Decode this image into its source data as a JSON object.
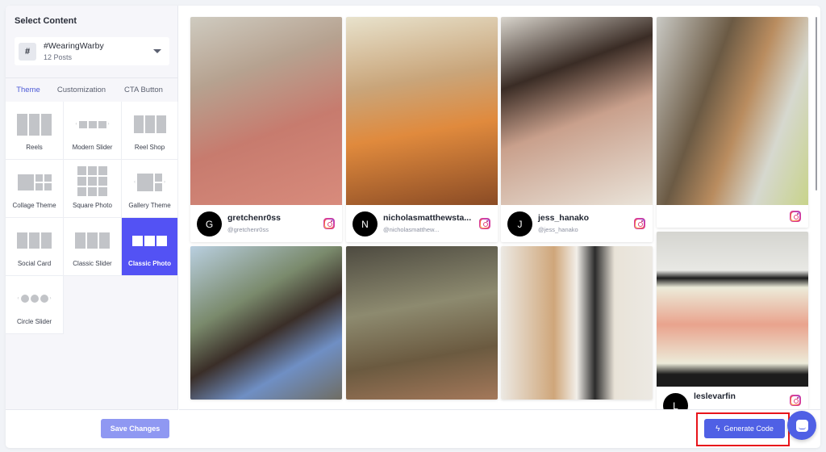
{
  "sidebar": {
    "title": "Select Content",
    "source": {
      "icon": "#",
      "name": "#WearingWarby",
      "count": "12 Posts"
    },
    "tabs": [
      {
        "label": "Theme",
        "active": true
      },
      {
        "label": "Customization",
        "active": false
      },
      {
        "label": "CTA Button",
        "active": false
      }
    ],
    "themes": [
      {
        "label": "Reels",
        "icon": "reels-layout-icon",
        "active": false
      },
      {
        "label": "Modern Slider",
        "icon": "modern-slider-layout-icon",
        "active": false
      },
      {
        "label": "Reel Shop",
        "icon": "reel-shop-layout-icon",
        "active": false
      },
      {
        "label": "Collage Theme",
        "icon": "collage-layout-icon",
        "active": false
      },
      {
        "label": "Square Photo",
        "icon": "square-photo-layout-icon",
        "active": false
      },
      {
        "label": "Gallery Theme",
        "icon": "gallery-layout-icon",
        "active": false
      },
      {
        "label": "Social Card",
        "icon": "social-card-layout-icon",
        "active": false
      },
      {
        "label": "Classic Slider",
        "icon": "classic-slider-layout-icon",
        "active": false
      },
      {
        "label": "Classic Photo",
        "icon": "classic-photo-layout-icon",
        "active": true
      },
      {
        "label": "Circle Slider",
        "icon": "circle-slider-layout-icon",
        "active": false
      }
    ],
    "save_label": "Save Changes"
  },
  "feed": {
    "posts": [
      {
        "initial": "G",
        "name": "gretchenr0ss",
        "handle": "@gretchenr0ss",
        "photo": "woman-with-tortoiseshell-glasses-selfie"
      },
      {
        "initial": "N",
        "name": "nicholasmatthewsta...",
        "handle": "@nicholasmatthew...",
        "photo": "man-in-orange-shirt-at-bar"
      },
      {
        "initial": "J",
        "name": "jess_hanako",
        "handle": "@jess_hanako",
        "photo": "woman-with-bangs-and-clear-glasses"
      },
      {
        "initial": "",
        "name": "",
        "handle": "",
        "photo": "woman-with-braids-and-headscarf"
      },
      {
        "initial": "",
        "name": "",
        "handle": "",
        "photo": "men-laughing-at-outdoor-table"
      },
      {
        "initial": "",
        "name": "",
        "handle": "",
        "photo": "woman-among-cactus-plants"
      },
      {
        "initial": "",
        "name": "",
        "handle": "",
        "photo": "woman-full-length-in-room"
      },
      {
        "initial": "L",
        "name": "leslevarfin",
        "handle": "",
        "photo": "cat-painting-with-glasses-on-wall"
      }
    ]
  },
  "footer": {
    "generate_label": "Generate Code"
  },
  "colors": {
    "accent": "#5352f4",
    "primary_button": "#4f60e5",
    "save_button_disabled": "#8f98f2",
    "highlight": "#e8141b"
  }
}
